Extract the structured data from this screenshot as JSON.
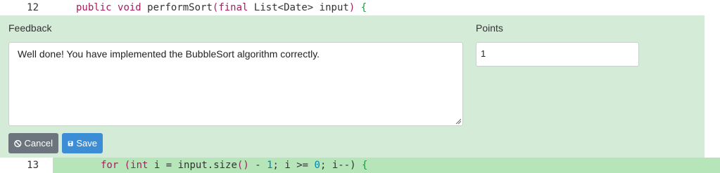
{
  "code": {
    "line12": {
      "number": "12",
      "tokens": {
        "t1": "public",
        "t2": "void",
        "t3": "performSort",
        "t4": "(",
        "t5": "final",
        "t6": "List<Date>",
        "t7": "input",
        "t8": ")",
        "t9": "{"
      }
    },
    "line13": {
      "number": "13",
      "tokens": {
        "t1": "for",
        "t2": "(",
        "t3": "int",
        "t4": "i = input.size",
        "t5": "()",
        "t6": "-",
        "t7": "1",
        "t8": "; i >=",
        "t9": "0",
        "t10": "; i--)",
        "t11": "{"
      }
    }
  },
  "feedback": {
    "label": "Feedback",
    "text": "Well done! You have implemented the BubbleSort algorithm correctly."
  },
  "points": {
    "label": "Points",
    "value": "1"
  },
  "buttons": {
    "cancel": "Cancel",
    "save": "Save"
  },
  "icons": {
    "cancel": "ban-icon",
    "save": "floppy-disk-icon"
  },
  "colors": {
    "panel_bg": "#d4ebd8",
    "highlight": "#b6e5b9",
    "cancel_bg": "#6c757d",
    "save_bg": "#3c8dd6"
  }
}
